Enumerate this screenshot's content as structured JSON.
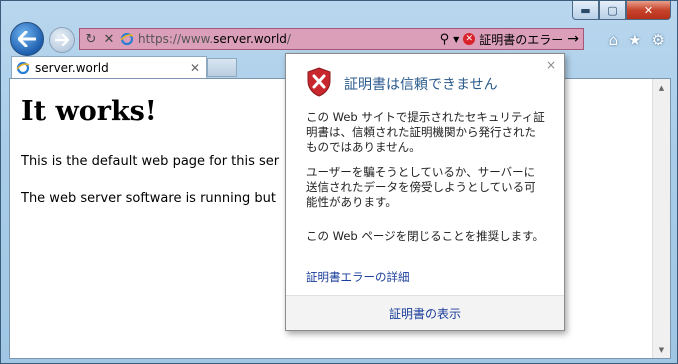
{
  "window": {
    "controls": {
      "minimize": "▬",
      "maximize": "▢",
      "close": "✕"
    }
  },
  "nav": {
    "back_icon": "arrow-left-icon",
    "forward_icon": "arrow-right-icon"
  },
  "address_bar": {
    "url_prefix": "https://www.",
    "url_host": "server.world",
    "url_suffix": "/",
    "certificate_error_label": "証明書のエラー",
    "icons": [
      "refresh-icon",
      "stop-icon",
      "ie-icon",
      "search-icon",
      "dropdown-icon",
      "cert-error-icon",
      "go-icon"
    ]
  },
  "toolbar": {
    "home": "⌂",
    "favorites": "★",
    "tools": "⚙"
  },
  "tabs": [
    {
      "label": "server.world",
      "close": "✕"
    }
  ],
  "page": {
    "heading": "It works!",
    "para1": "This is the default web page for this ser",
    "para2": "The web server software is running but"
  },
  "popup": {
    "title": "証明書は信頼できません",
    "close": "×",
    "text1": "この Web サイトで提示されたセキュリティ証明書は、信頼された証明機関から発行されたものではありません。",
    "text2": "ユーザーを騙そうとしているか、サーバーに送信されたデータを傍受しようとしている可能性があります。",
    "text3": "この Web ページを閉じることを推奨します。",
    "details_link": "証明書エラーの詳細",
    "view_cert_link": "証明書の表示"
  },
  "colors": {
    "address_bar_error": "#dc9fb9",
    "title_blue": "#2b5b8c",
    "link_blue": "#1a3d9b"
  }
}
